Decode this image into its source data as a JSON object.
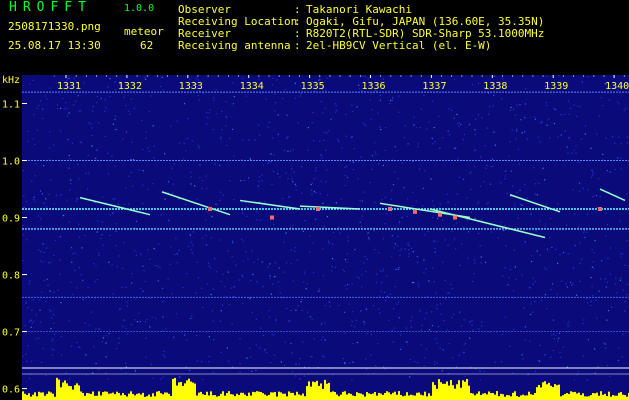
{
  "header": {
    "app_name": "HROFFT",
    "version": "1.0.0",
    "file_name": "2508171330.png",
    "timestamp": "25.08.17 13:30",
    "detection_label": "meteor",
    "detection_count": "62",
    "info": [
      {
        "label": "Observer",
        "value": "Takanori Kawachi"
      },
      {
        "label": "Receiving Location",
        "value": "Ogaki, Gifu, JAPAN (136.60E, 35.35N)"
      },
      {
        "label": "Receiver",
        "value": "R820T2(RTL-SDR) SDR-Sharp 53.1000MHz"
      },
      {
        "label": "Receiving antenna",
        "value": "2el-HB9CV Vertical (el. E-W)"
      }
    ]
  },
  "plot": {
    "unit_label": "kHz",
    "time_labels": [
      "1331",
      "1332",
      "1333",
      "1334",
      "1335",
      "1336",
      "1337",
      "1338",
      "1339",
      "1340"
    ],
    "freq_labels": [
      "1.1",
      "1.0",
      "0.9",
      "0.8",
      "0.7",
      "0.6"
    ],
    "colors": {
      "background": "#0a0a7a",
      "text": "#ffff33",
      "app_name": "#00ff33",
      "tick": "#ffffff",
      "level_bars": "#ffff00",
      "signal": "#66ffff"
    }
  }
}
